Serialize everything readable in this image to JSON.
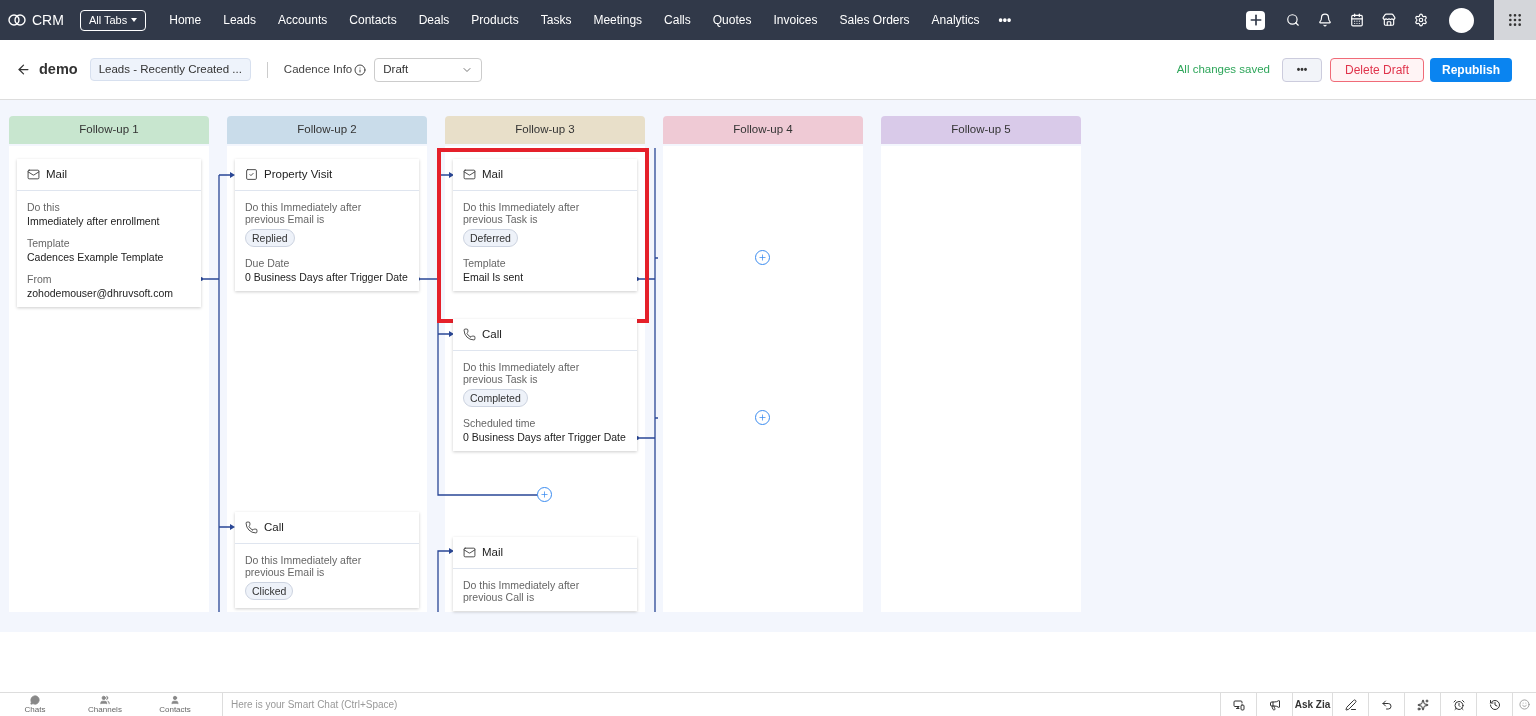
{
  "nav": {
    "app": "CRM",
    "all_tabs": "All Tabs",
    "tabs": [
      {
        "label": "Home",
        "selected": false
      },
      {
        "label": "Leads",
        "selected": false
      },
      {
        "label": "Accounts",
        "selected": false
      },
      {
        "label": "Contacts",
        "selected": false
      },
      {
        "label": "Deals",
        "selected": false
      },
      {
        "label": "Products",
        "selected": false
      },
      {
        "label": "Tasks",
        "selected": false
      },
      {
        "label": "Meetings",
        "selected": false
      },
      {
        "label": "Calls",
        "selected": false
      },
      {
        "label": "Quotes",
        "selected": false
      },
      {
        "label": "Invoices",
        "selected": false
      },
      {
        "label": "Sales Orders",
        "selected": false
      },
      {
        "label": "Analytics",
        "selected": false
      }
    ],
    "more": "•••"
  },
  "header": {
    "title": "demo",
    "module": "Leads - Recently Created ...",
    "info_label": "Cadence Info",
    "status": "Draft",
    "saved": "All changes saved",
    "more": "•••",
    "delete": "Delete Draft",
    "publish": "Republish"
  },
  "columns": [
    {
      "title": "Follow-up 1",
      "color": "#c8e6cf",
      "cards": [
        {
          "kind": "mail",
          "title": "Mail",
          "highlighted": false,
          "fields": [
            {
              "label": "Do this",
              "value": "Immediately after enrollment"
            },
            {
              "label": "Template",
              "value": "Cadences Example Template"
            },
            {
              "label": "From",
              "value": "zohodemouser@dhruvsoft.com"
            }
          ]
        }
      ]
    },
    {
      "title": "Follow-up 2",
      "color": "#c9dcea",
      "cards": [
        {
          "kind": "task",
          "title": "Property Visit",
          "highlighted": false,
          "condition": "Do this Immediately after previous Email is",
          "badge": "Replied",
          "fields": [
            {
              "label": "Due Date",
              "value": "0 Business Days after Trigger Date"
            }
          ]
        },
        {
          "kind": "call",
          "title": "Call",
          "highlighted": false,
          "condition": "Do this Immediately after previous Email is",
          "badge": "Clicked"
        }
      ]
    },
    {
      "title": "Follow-up 3",
      "color": "#e8dfc9",
      "cards": [
        {
          "kind": "mail",
          "title": "Mail",
          "highlighted": true,
          "condition": "Do this Immediately after previous Task is",
          "badge": "Deferred",
          "fields": [
            {
              "label": "Template",
              "value": "Email Is sent"
            }
          ]
        },
        {
          "kind": "call",
          "title": "Call",
          "highlighted": false,
          "condition": "Do this Immediately after previous Task is",
          "badge": "Completed",
          "fields": [
            {
              "label": "Scheduled time",
              "value": "0 Business Days after Trigger Date"
            }
          ]
        },
        {
          "kind": "mail",
          "title": "Mail",
          "highlighted": false,
          "condition": "Do this Immediately after previous Call is"
        }
      ]
    },
    {
      "title": "Follow-up 4",
      "color": "#efcad5"
    },
    {
      "title": "Follow-up 5",
      "color": "#d9cae9"
    }
  ],
  "footer": {
    "items": [
      "Chats",
      "Channels",
      "Contacts"
    ],
    "chat_placeholder": "Here is your Smart Chat (Ctrl+Space)",
    "ask": "Ask Zia"
  }
}
